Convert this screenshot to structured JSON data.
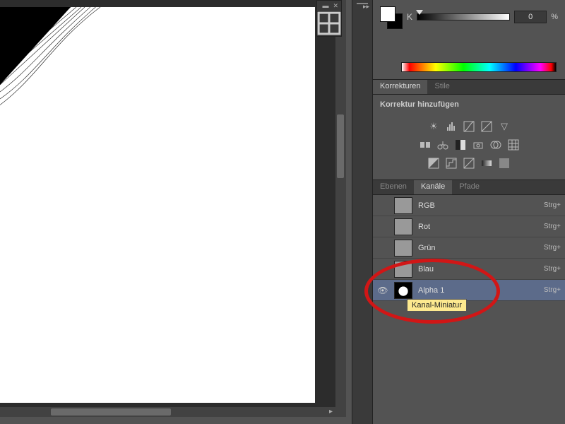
{
  "color": {
    "label": "K",
    "value": "0",
    "unit": "%"
  },
  "adjustments": {
    "tab1": "Korrekturen",
    "tab2": "Stile",
    "subtitle": "Korrektur hinzufügen"
  },
  "panelTabs": {
    "t1": "Ebenen",
    "t2": "Kanäle",
    "t3": "Pfade"
  },
  "channels": [
    {
      "name": "RGB",
      "shortcut": "Strg+",
      "visible": false
    },
    {
      "name": "Rot",
      "shortcut": "Strg+",
      "visible": false
    },
    {
      "name": "Grün",
      "shortcut": "Strg+",
      "visible": false
    },
    {
      "name": "Blau",
      "shortcut": "Strg+",
      "visible": false
    },
    {
      "name": "Alpha 1",
      "shortcut": "Strg+",
      "visible": true,
      "selected": true,
      "alpha": true
    }
  ],
  "tooltip": "Kanal-Miniatur"
}
